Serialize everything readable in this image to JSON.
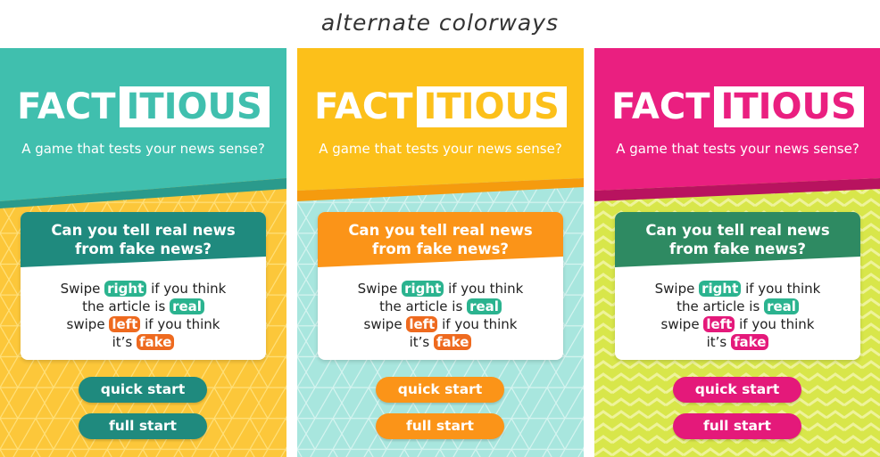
{
  "page_title": "alternate colorways",
  "app": {
    "name_part1": "FACT",
    "name_part2": "ITIOUS",
    "tagline": "A game that tests your news sense?",
    "question_line1": "Can you tell real news",
    "question_line2": "from fake news?",
    "swipe_word": "Swipe",
    "right_label": "right",
    "if_you_think": "if you think",
    "the_article_is": "the article is",
    "real_label": "real",
    "swipe_lower": "swipe",
    "left_label": "left",
    "its": "it’s",
    "fake_label": "fake",
    "quick_start_label": "quick start",
    "full_start_label": "full start"
  },
  "colorways": [
    {
      "header": "#40bfae",
      "header_shadow": "#2a9a8c",
      "background": "#fcc73a",
      "card_header": "#1f8a7e",
      "button": "#1f8a7e",
      "right_pill": "#2bb38f",
      "real_pill": "#2bb38f",
      "left_pill": "#ee6a1f",
      "fake_pill": "#ee6a1f",
      "logo_accent": "#40bfae",
      "pattern": "triangles-yellow"
    },
    {
      "header": "#fcc01a",
      "header_shadow": "#e59a10",
      "background": "#a8e6de",
      "card_header": "#fb9418",
      "button": "#fb9418",
      "right_pill": "#2bb38f",
      "real_pill": "#2bb38f",
      "left_pill": "#ee6a1f",
      "fake_pill": "#ee6a1f",
      "logo_accent": "#fcc01a",
      "pattern": "triangles-mint"
    },
    {
      "header": "#ea1f80",
      "header_shadow": "#b8135f",
      "background": "#d8e64a",
      "card_header": "#2e8a62",
      "button": "#e4197a",
      "right_pill": "#2bb38f",
      "real_pill": "#2bb38f",
      "left_pill": "#e4197a",
      "fake_pill": "#e4197a",
      "logo_accent": "#ea1f80",
      "pattern": "chevron-lime"
    }
  ]
}
